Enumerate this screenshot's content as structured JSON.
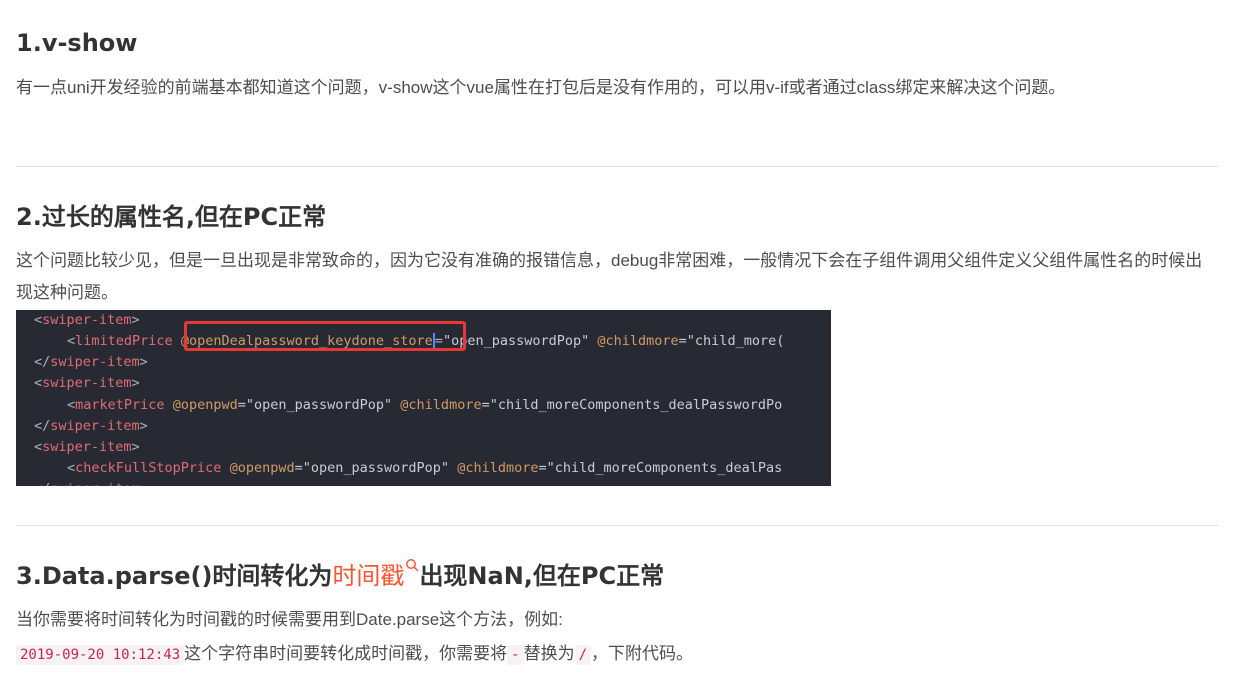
{
  "sections": [
    {
      "title": "1.v-show",
      "body": "有一点uni开发经验的前端基本都知道这个问题，v-show这个vue属性在打包后是没有作用的，可以用v-if或者通过class绑定来解决这个问题。"
    },
    {
      "title": "2.过长的属性名,但在PC正常",
      "body": "这个问题比较少见，但是一旦出现是非常致命的，因为它没有准确的报错信息，debug非常困难，一般情况下会在子组件调用父组件定义父组件属性名的时候出现这种问题。"
    },
    {
      "title_before": "3.Data.parse()时间转化为",
      "title_link": "时间戳",
      "title_after": "出现NaN,但在PC正常",
      "body_line1": "当你需要将时间转化为时间戳的时候需要用到Date.parse这个方法，例如:",
      "code_example": "2019-09-20 10:12:43",
      "body_line2_a": "这个字符串时间要转化成时间戳，你需要将",
      "code_dash": "-",
      "body_line2_b": "替换为",
      "code_slash": "/",
      "body_line2_c": "，下附代码。"
    }
  ],
  "code_screenshot": {
    "lines": [
      {
        "open": "<",
        "tag": "swiper-item",
        "close": ">"
      },
      {
        "tag": "limitedPrice",
        "attr1": "@openDealpassword_keydone_store",
        "eq": "=",
        "val1": "\"open_passwordPop\"",
        "attr2": "@childmore",
        "val2": "=\"child_more("
      },
      {
        "open": "</",
        "tag": "swiper-item",
        "close": ">"
      },
      {
        "open": "<",
        "tag": "swiper-item",
        "close": ">"
      },
      {
        "tag": "marketPrice",
        "attr1": "@openpwd",
        "val1": "=\"open_passwordPop\"",
        "attr2": "@childmore",
        "val2": "=\"child_moreComponents_dealPasswordPo"
      },
      {
        "open": "</",
        "tag": "swiper-item",
        "close": ">"
      },
      {
        "open": "<",
        "tag": "swiper-item",
        "close": ">"
      },
      {
        "tag": "checkFullStopPrice",
        "attr1": "@openpwd",
        "val1": "=\"open_passwordPop\"",
        "attr2": "@childmore",
        "val2": "=\"child_moreComponents_dealPas"
      },
      {
        "open": "</",
        "tag": "swiper-item",
        "close": ">"
      }
    ]
  },
  "colors": {
    "heading": "#333333",
    "body_text": "#4d4d4d",
    "keyword_link": "#fc5531",
    "inline_code": "#c7254e",
    "code_bg": "#272a33",
    "highlight_box": "#e53935"
  },
  "icons": {
    "keyword_search": "search-icon"
  }
}
